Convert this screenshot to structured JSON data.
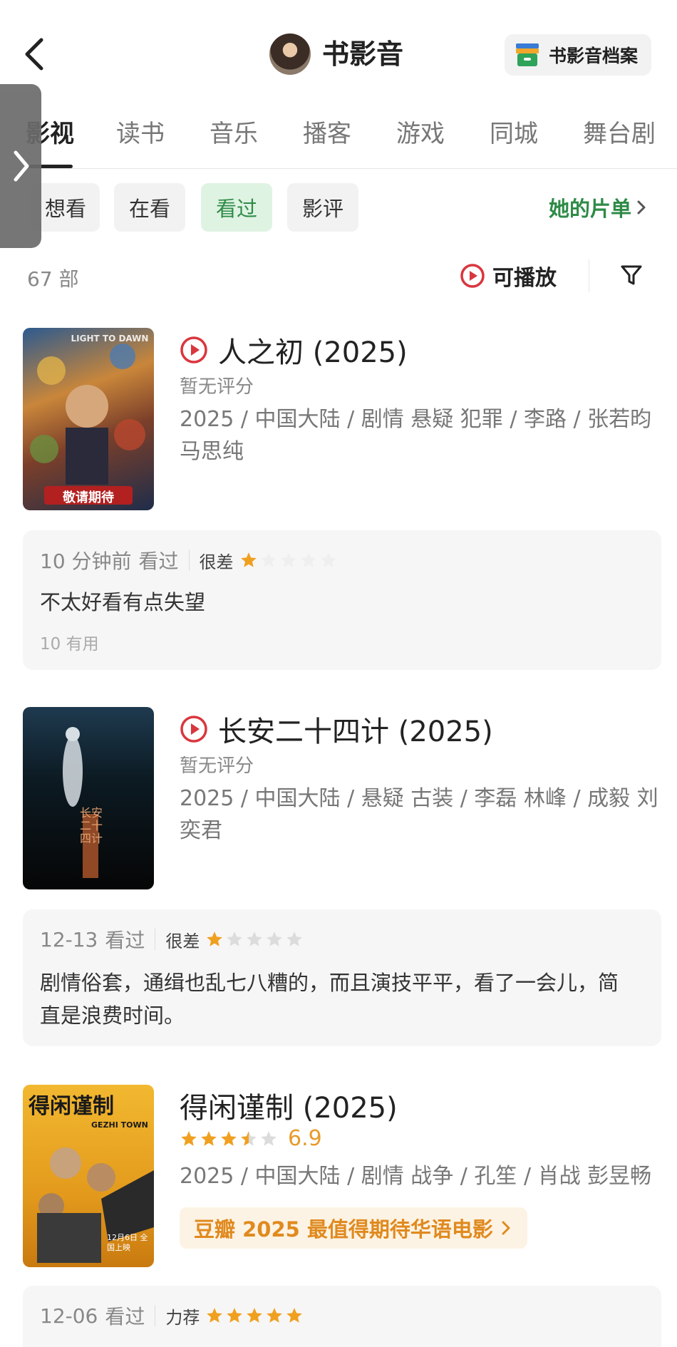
{
  "header": {
    "back_icon": "chevron-left-icon",
    "title": "书影音",
    "archive_label": "书影音档案",
    "archive_icon": "archive-box-icon"
  },
  "tabs": [
    {
      "label": "影视",
      "active": true
    },
    {
      "label": "读书",
      "active": false
    },
    {
      "label": "音乐",
      "active": false
    },
    {
      "label": "播客",
      "active": false
    },
    {
      "label": "游戏",
      "active": false
    },
    {
      "label": "同城",
      "active": false
    },
    {
      "label": "舞台剧",
      "active": false
    }
  ],
  "filters": [
    {
      "label": "想看",
      "active": false
    },
    {
      "label": "在看",
      "active": false
    },
    {
      "label": "看过",
      "active": true
    },
    {
      "label": "影评",
      "active": false
    }
  ],
  "her_list_label": "她的片单",
  "count_label": "67 部",
  "playable_label": "可播放",
  "colors": {
    "green": "#2e8b47",
    "red": "#d9363e",
    "star": "#f0a020",
    "promo": "#e08a1f"
  },
  "items": [
    {
      "title": "人之初 (2025)",
      "playable": true,
      "rating_text": "暂无评分",
      "meta": "2025 / 中国大陆 / 剧情 悬疑 犯罪 / 李路 / 张若昀 马思纯",
      "poster_caption": "敬请期待",
      "poster_label": "LIGHT TO DAWN",
      "review": {
        "time": "10 分钟前",
        "status": "看过",
        "level": "很差",
        "stars": 1,
        "text": "不太好看有点失望",
        "useful": "10 有用"
      }
    },
    {
      "title": "长安二十四计 (2025)",
      "playable": true,
      "rating_text": "暂无评分",
      "meta": "2025 / 中国大陆 / 悬疑 古装 / 李磊 林峰 / 成毅 刘奕君",
      "poster_caption": "长安二十四计",
      "review": {
        "time": "12-13",
        "status": "看过",
        "level": "很差",
        "stars": 1,
        "text": "剧情俗套，通缉也乱七八糟的，而且演技平平，看了一会儿，简直是浪费时间。"
      }
    },
    {
      "title": "得闲谨制 (2025)",
      "playable": false,
      "stars": 3.5,
      "score": "6.9",
      "meta": "2025 / 中国大陆 / 剧情 战争 / 孔笙 / 肖战 彭昱畅",
      "promo": "豆瓣 2025 最值得期待华语电影",
      "poster_caption": "得闲谨制",
      "poster_sub": "GEZHI TOWN",
      "poster_date": "12月6日 全国上映",
      "review": {
        "time": "12-06",
        "status": "看过",
        "level": "力荐",
        "stars": 5
      }
    }
  ]
}
